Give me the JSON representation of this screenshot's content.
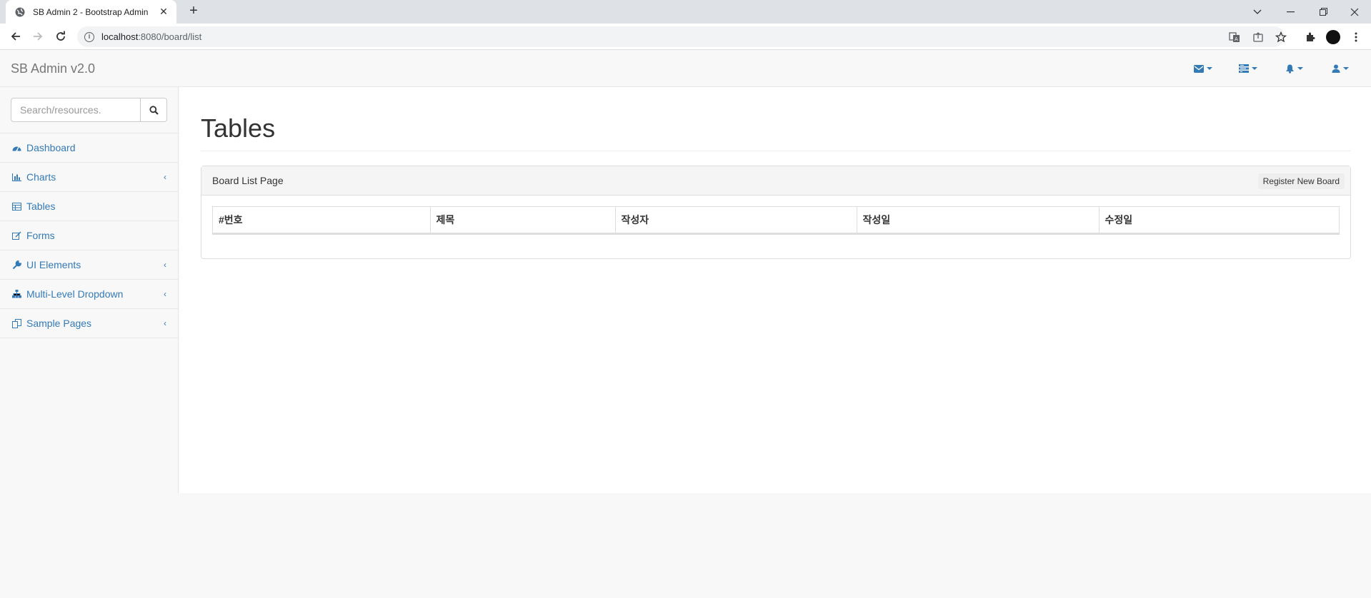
{
  "browser": {
    "tab_title": "SB Admin 2 - Bootstrap Admin",
    "url_host": "localhost",
    "url_path": ":8080/board/list"
  },
  "navbar": {
    "brand": "SB Admin v2.0",
    "icons": [
      "envelope-icon",
      "tasks-icon",
      "bell-icon",
      "user-icon"
    ]
  },
  "sidebar": {
    "search_placeholder": "Search/resources.",
    "items": [
      {
        "label": "Dashboard",
        "icon": "dashboard-icon",
        "has_arrow": false
      },
      {
        "label": "Charts",
        "icon": "bar-chart-icon",
        "has_arrow": true
      },
      {
        "label": "Tables",
        "icon": "table-icon",
        "has_arrow": false
      },
      {
        "label": "Forms",
        "icon": "edit-icon",
        "has_arrow": false
      },
      {
        "label": "UI Elements",
        "icon": "wrench-icon",
        "has_arrow": true
      },
      {
        "label": "Multi-Level Dropdown",
        "icon": "sitemap-icon",
        "has_arrow": true
      },
      {
        "label": "Sample Pages",
        "icon": "files-icon",
        "has_arrow": true
      }
    ]
  },
  "main": {
    "title": "Tables",
    "panel": {
      "heading": "Board List Page",
      "register_button": "Register New Board",
      "columns": [
        "#번호",
        "제목",
        "작성자",
        "작성일",
        "수정일"
      ]
    }
  },
  "colors": {
    "link": "#337ab7",
    "sidebar_bg": "#f8f8f8",
    "border": "#e7e7e7"
  }
}
